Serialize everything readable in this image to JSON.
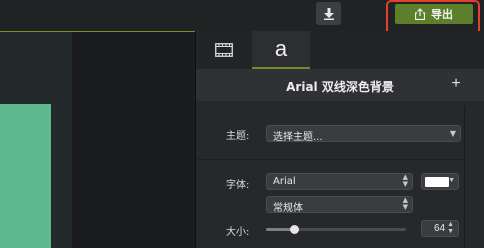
{
  "toolbar": {
    "download_icon": "download-arrow-icon",
    "export_label": "导出",
    "export_icon": "share-upload-icon",
    "colors": {
      "export_bg": "#5c7f2c",
      "highlight": "#e3412c"
    }
  },
  "canvas": {
    "shape_color": "#5fb98f"
  },
  "panel": {
    "tabs": [
      {
        "icon": "film-icon",
        "label": ""
      },
      {
        "label": "a"
      }
    ],
    "header": {
      "title": "Arial 双线深色背景",
      "add_label": "+"
    },
    "theme": {
      "label": "主题:",
      "value": "选择主题..."
    },
    "font": {
      "label": "字体:",
      "family": "Arial",
      "style": "常规体",
      "color": "#ffffff"
    },
    "size": {
      "label": "大小:",
      "value": "64",
      "level": 0.2
    }
  }
}
